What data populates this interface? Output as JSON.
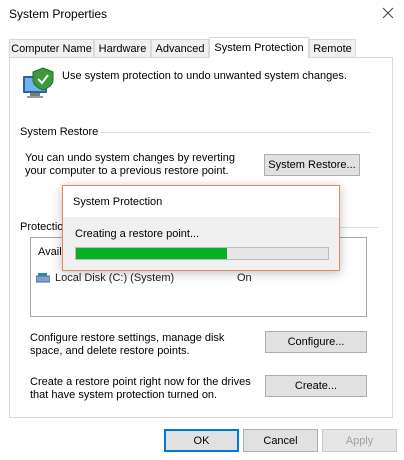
{
  "window": {
    "title": "System Properties"
  },
  "tabs": [
    {
      "label": "Computer Name"
    },
    {
      "label": "Hardware"
    },
    {
      "label": "Advanced"
    },
    {
      "label": "System Protection"
    },
    {
      "label": "Remote"
    }
  ],
  "intro_text": "Use system protection to undo unwanted system changes.",
  "system_restore": {
    "group_label": "System Restore",
    "description": "You can undo system changes by reverting your computer to a previous restore point.",
    "button_label": "System Restore..."
  },
  "protection_settings": {
    "group_label": "Protection Settings",
    "header_partial": "Availa",
    "drive_row": {
      "name": "Local Disk (C:) (System)",
      "protection": "On"
    }
  },
  "configure": {
    "text": "Configure restore settings, manage disk space, and delete restore points.",
    "button_label": "Configure..."
  },
  "create": {
    "text": "Create a restore point right now for the drives that have system protection turned on.",
    "button_label": "Create..."
  },
  "footer": {
    "ok": "OK",
    "cancel": "Cancel",
    "apply": "Apply"
  },
  "progress_dialog": {
    "title": "System Protection",
    "message": "Creating a restore point...",
    "progress_fraction": 0.6
  },
  "colors": {
    "accent": "#d98c5f",
    "progress": "#06b025"
  }
}
